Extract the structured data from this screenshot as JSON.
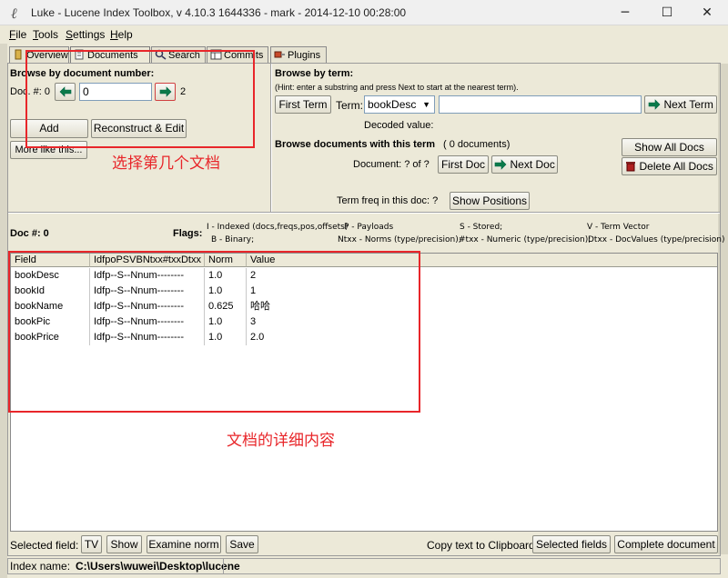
{
  "window": {
    "title": "Luke - Lucene Index Toolbox, v 4.10.3 1644336 - mark - 2014-12-10 00:28:00",
    "minimize": "─",
    "maximize": "☐",
    "close": "✕"
  },
  "menu": [
    {
      "mn": "F",
      "rest": "ile"
    },
    {
      "mn": "T",
      "rest": "ools"
    },
    {
      "mn": "S",
      "rest": "ettings"
    },
    {
      "mn": "H",
      "rest": "elp"
    }
  ],
  "tabs": [
    "Overview",
    "Documents",
    "Search",
    "Commits",
    "Plugins"
  ],
  "browse_doc": {
    "heading": "Browse by document number:",
    "doc_label": "Doc. #: 0",
    "doc_value": "0",
    "max_doc": "2",
    "add": "Add",
    "reconstruct": "Reconstruct & Edit",
    "more_like": "More like this..."
  },
  "browse_term": {
    "heading": "Browse by term:",
    "hint": "(Hint: enter a substring and press Next to start at the nearest term).",
    "first_term": "First Term",
    "term_label": "Term:",
    "field_select": "bookDesc",
    "term_value": "",
    "next_term": "Next Term",
    "decoded_label": "Decoded value:"
  },
  "browse_docs_term": {
    "heading": "Browse documents with this term",
    "count": "( 0  documents)",
    "document_label": "Document: ?  of  ?",
    "first_doc": "First Doc",
    "next_doc": "Next Doc",
    "show_all": "Show All Docs",
    "delete_all": "Delete All Docs",
    "term_freq": "Term freq in this doc: ?",
    "show_positions": "Show Positions"
  },
  "annotations": {
    "select_doc": "选择第几个文档",
    "doc_detail": "文档的详细内容"
  },
  "doc_info": {
    "doc_num": "Doc #: 0",
    "flags_label": "Flags:",
    "flags_row1": [
      "I - Indexed (docs,freqs,pos,offsets)",
      "P - Payloads",
      "S - Stored;",
      "V - Term Vector"
    ],
    "flags_row2": [
      "B - Binary;",
      "Ntxx - Norms (type/precision);",
      "#txx - Numeric (type/precision);",
      "Dtxx - DocValues (type/precision)"
    ]
  },
  "table": {
    "headers": [
      "Field",
      "IdfpoPSVBNtxx#txxDtxx",
      "Norm",
      "Value"
    ],
    "rows": [
      [
        "bookDesc",
        "Idfp--S--Nnum--------",
        "1.0",
        "2"
      ],
      [
        "bookId",
        "Idfp--S--Nnum--------",
        "1.0",
        "1"
      ],
      [
        "bookName",
        "Idfp--S--Nnum--------",
        "0.625",
        "哈哈"
      ],
      [
        "bookPic",
        "Idfp--S--Nnum--------",
        "1.0",
        "3"
      ],
      [
        "bookPrice",
        "Idfp--S--Nnum--------",
        "1.0",
        "2.0"
      ]
    ]
  },
  "bottom": {
    "selected_field": "Selected field:",
    "tv": "TV",
    "show": "Show",
    "examine_norm": "Examine norm",
    "save": "Save",
    "copy_label": "Copy text to Clipboard:",
    "selected_fields": "Selected fields",
    "complete_document": "Complete document"
  },
  "status": {
    "label": "Index name:",
    "path": "C:\\Users\\wuwei\\Desktop\\lucene"
  }
}
